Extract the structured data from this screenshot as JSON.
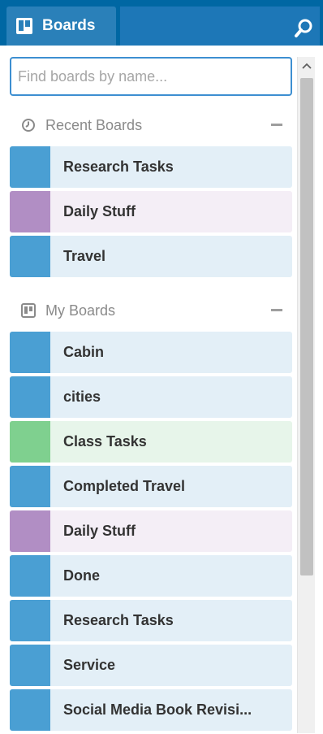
{
  "header": {
    "boards_label": "Boards",
    "accent": "#0067a3",
    "icons": {
      "boards": "boards-icon",
      "search": "search-icon"
    }
  },
  "search": {
    "placeholder": "Find boards by name...",
    "value": ""
  },
  "recent": {
    "title": "Recent Boards",
    "icon": "clock-icon",
    "collapse_icon": "minus-icon",
    "boards": [
      {
        "name": "Research Tasks",
        "color": "#4a9fd3",
        "bg": "#e3eff7"
      },
      {
        "name": "Daily Stuff",
        "color": "#b18ec4",
        "bg": "#f4eef6"
      },
      {
        "name": "Travel",
        "color": "#4a9fd3",
        "bg": "#e3eff7"
      }
    ]
  },
  "my": {
    "title": "My Boards",
    "icon": "boards-outline-icon",
    "collapse_icon": "minus-icon",
    "boards": [
      {
        "name": "Cabin",
        "color": "#4a9fd3",
        "bg": "#e3eff7"
      },
      {
        "name": "cities",
        "color": "#4a9fd3",
        "bg": "#e3eff7"
      },
      {
        "name": "Class Tasks",
        "color": "#7fd08f",
        "bg": "#e7f5ea"
      },
      {
        "name": "Completed Travel",
        "color": "#4a9fd3",
        "bg": "#e3eff7"
      },
      {
        "name": "Daily Stuff",
        "color": "#b18ec4",
        "bg": "#f4eef6"
      },
      {
        "name": "Done",
        "color": "#4a9fd3",
        "bg": "#e3eff7"
      },
      {
        "name": "Research Tasks",
        "color": "#4a9fd3",
        "bg": "#e3eff7"
      },
      {
        "name": "Service",
        "color": "#4a9fd3",
        "bg": "#e3eff7"
      },
      {
        "name": "Social Media Book Revisi...",
        "color": "#4a9fd3",
        "bg": "#e3eff7"
      }
    ]
  }
}
